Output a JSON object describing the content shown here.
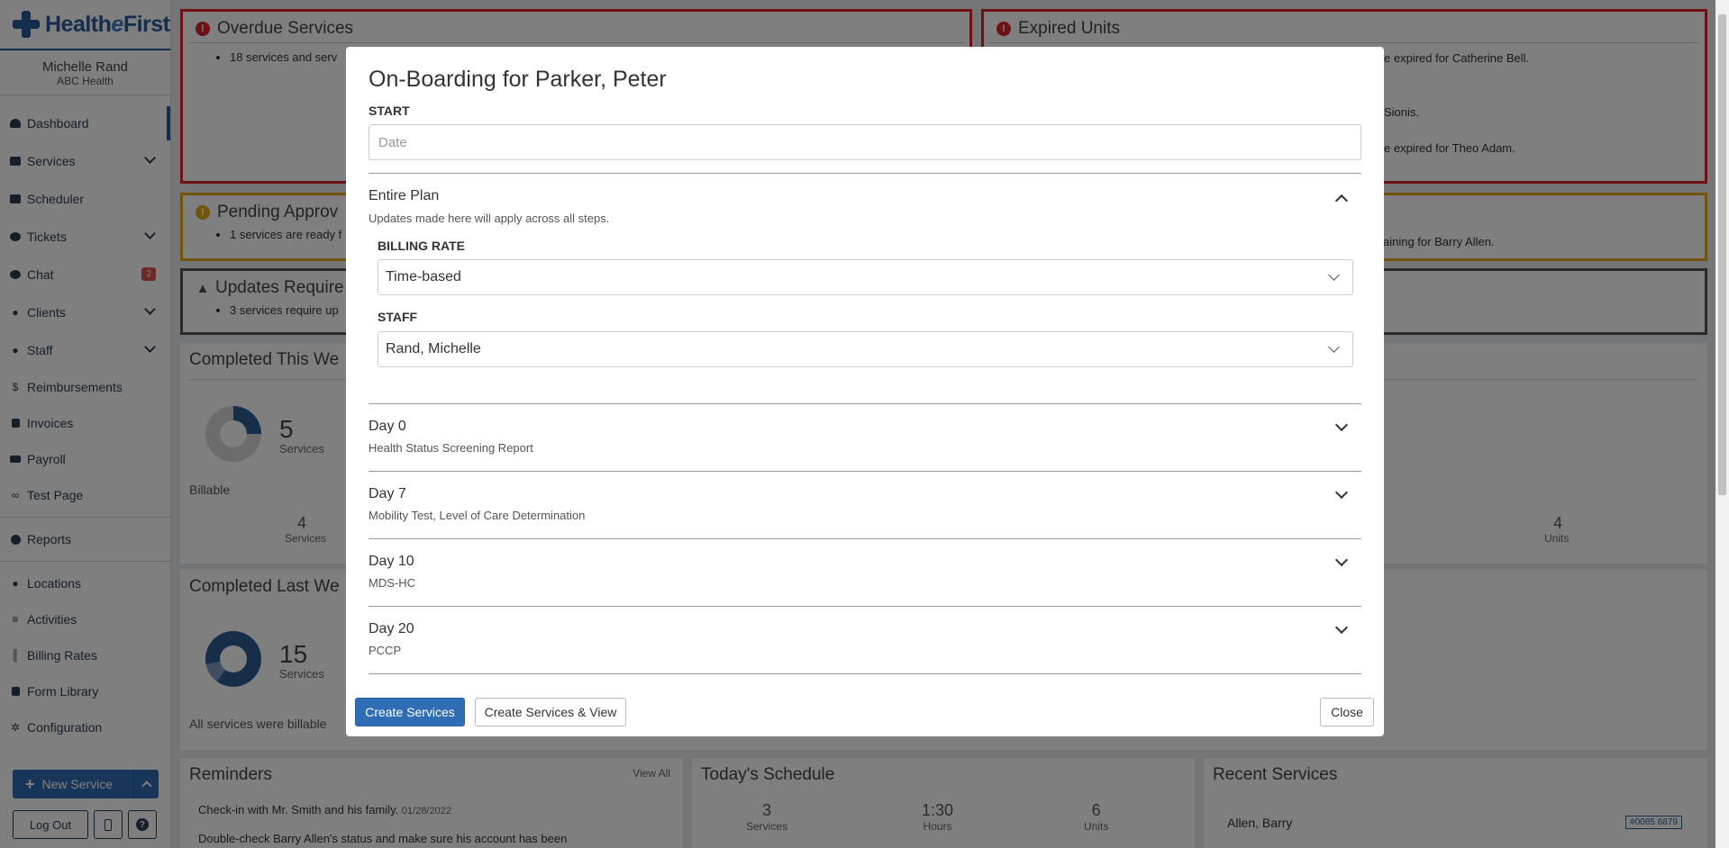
{
  "app": {
    "logo": {
      "prefix": "Health",
      "italic": "e",
      "suffix": "First"
    },
    "user_name": "Michelle Rand",
    "user_org": "ABC Health"
  },
  "sidebar": {
    "items": [
      {
        "label": "Dashboard",
        "icon": "dashboard-icon"
      },
      {
        "label": "Services",
        "icon": "services-icon"
      },
      {
        "label": "Scheduler",
        "icon": "calendar-icon"
      },
      {
        "label": "Tickets",
        "icon": "headset-icon"
      },
      {
        "label": "Chat",
        "icon": "chat-icon",
        "badge": "2"
      },
      {
        "label": "Clients",
        "icon": "user-icon"
      },
      {
        "label": "Staff",
        "icon": "staff-icon"
      },
      {
        "label": "Reimbursements",
        "icon": "dollar-icon"
      },
      {
        "label": "Invoices",
        "icon": "invoice-icon"
      },
      {
        "label": "Payroll",
        "icon": "money-icon"
      },
      {
        "label": "Test Page",
        "icon": "link-icon"
      },
      {
        "label": "Reports",
        "icon": "pie-chart-icon"
      },
      {
        "label": "Locations",
        "icon": "map-marker-icon"
      },
      {
        "label": "Activities",
        "icon": "list-icon"
      },
      {
        "label": "Billing Rates",
        "icon": "barcode-icon"
      },
      {
        "label": "Form Library",
        "icon": "file-icon"
      },
      {
        "label": "Configuration",
        "icon": "cogs-icon"
      }
    ],
    "new_service": "New Service",
    "logout": "Log Out"
  },
  "dashboard": {
    "overdue": {
      "title": "Overdue Services",
      "items": [
        "18 services and serv"
      ]
    },
    "expired": {
      "title": "Expired Units",
      "lines": [
        "e expired for Catherine Bell.",
        "Sionis.",
        "e expired for Theo Adam."
      ]
    },
    "pending": {
      "title": "Pending Approv",
      "items": [
        "1 services are ready f"
      ],
      "right": "aining for Barry Allen."
    },
    "updates": {
      "title": "Updates Require",
      "items": [
        "3 services require up"
      ]
    },
    "completed_week": {
      "title": "Completed This We",
      "count": "5",
      "count_label": "Services",
      "billable": "Billable",
      "billable_count": "4",
      "billable_label": "Services",
      "units_count": "4",
      "units_label": "Units"
    },
    "completed_last": {
      "title": "Completed Last We",
      "count": "15",
      "count_label": "Services",
      "footer": "All services were billable"
    },
    "reminders": {
      "title": "Reminders",
      "view_all": "View All",
      "items": [
        {
          "text": "Check-in with Mr. Smith and his family.",
          "date": "01/28/2022"
        },
        {
          "text": "Double-check Barry Allen's status and make sure his account has been",
          "date": ""
        }
      ]
    },
    "schedule": {
      "title": "Today's Schedule",
      "stats": [
        {
          "value": "3",
          "label": "Services"
        },
        {
          "value": "1:30",
          "label": "Hours"
        },
        {
          "value": "6",
          "label": "Units"
        }
      ]
    },
    "recent": {
      "title": "Recent Services",
      "client": "Allen, Barry",
      "tag": "#0085 6879"
    }
  },
  "modal": {
    "title": "On-Boarding for Parker, Peter",
    "start_label": "START",
    "start_placeholder": "Date",
    "plan": {
      "title": "Entire Plan",
      "subtitle": "Updates made here will apply across all steps.",
      "billing_label": "BILLING RATE",
      "billing_value": "Time-based",
      "staff_label": "STAFF",
      "staff_value": "Rand, Michelle"
    },
    "steps": [
      {
        "title": "Day 0",
        "sub": "Health Status Screening Report"
      },
      {
        "title": "Day 7",
        "sub": "Mobility Test, Level of Care Determination"
      },
      {
        "title": "Day 10",
        "sub": "MDS-HC"
      },
      {
        "title": "Day 20",
        "sub": "PCCP"
      }
    ],
    "buttons": {
      "create": "Create Services",
      "create_view": "Create Services & View",
      "close": "Close"
    }
  }
}
